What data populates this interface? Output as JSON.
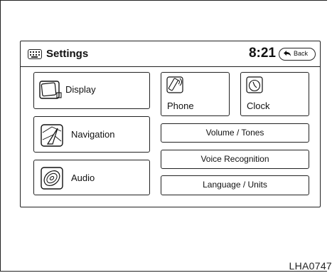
{
  "header": {
    "keyboard_icon": "keyboard-icon",
    "title": "Settings",
    "time": "8:21",
    "back_label": "Back"
  },
  "buttons": {
    "display": {
      "label": "Display",
      "icon": "display-icon"
    },
    "navigation": {
      "label": "Navigation",
      "icon": "navigation-icon"
    },
    "audio": {
      "label": "Audio",
      "icon": "audio-speaker-icon"
    },
    "phone": {
      "label": "Phone",
      "icon": "phone-icon"
    },
    "clock": {
      "label": "Clock",
      "icon": "clock-icon"
    },
    "volume": {
      "label": "Volume / Tones"
    },
    "voice": {
      "label": "Voice Recognition"
    },
    "language": {
      "label": "Language / Units"
    }
  },
  "figure_code": "LHA0747"
}
